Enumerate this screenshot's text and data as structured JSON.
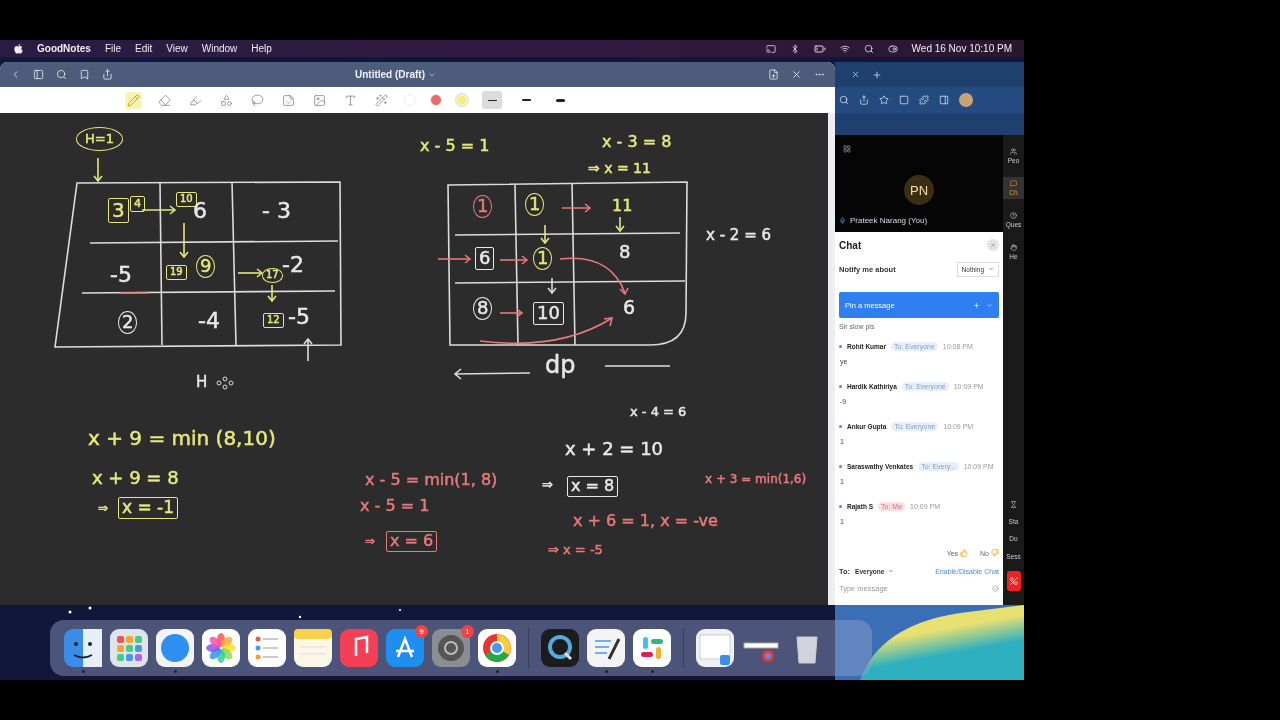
{
  "menu_bar": {
    "app": "GoodNotes",
    "menus": [
      "File",
      "Edit",
      "View",
      "Window",
      "Help"
    ],
    "clock": "Wed 16 Nov  10:10 PM"
  },
  "notes_window": {
    "title": "Untitled (Draft)",
    "tools": [
      {
        "selected": true
      },
      {
        "selected": false
      },
      {
        "selected": false
      },
      {
        "selected": false
      },
      {
        "selected": false
      },
      {
        "selected": false
      },
      {
        "selected": false
      },
      {
        "selected": false
      },
      {
        "selected": false
      }
    ],
    "colors": [
      {
        "color": "#ffffff",
        "selected": false
      },
      {
        "color": "#e86a6a",
        "selected": false
      },
      {
        "color": "#eef07a",
        "selected": true
      }
    ],
    "widths": [
      {
        "selected": true
      },
      {
        "selected": false
      },
      {
        "selected": false
      }
    ],
    "notes": [
      {
        "text": "H=1",
        "color": "#e6e77c",
        "kind": "oval"
      },
      {
        "text": "3",
        "color": "#e6e77c",
        "kind": "boxed"
      },
      {
        "text": "4",
        "color": "#e6e77c",
        "kind": "boxed"
      },
      {
        "text": "10",
        "color": "#e6e77c",
        "kind": "boxed"
      },
      {
        "text": "6",
        "color": "#e8e8e8",
        "kind": "plain"
      },
      {
        "text": "- 3",
        "color": "#e8e8e8",
        "kind": "plain"
      },
      {
        "text": "-5",
        "color": "#e8e8e8",
        "kind": "plain"
      },
      {
        "text": "19",
        "color": "#e6e77c",
        "kind": "boxed"
      },
      {
        "text": "9",
        "color": "#e6e77c",
        "kind": "circled"
      },
      {
        "text": "17",
        "color": "#e6e77c",
        "kind": "circled"
      },
      {
        "text": "-2",
        "color": "#e8e8e8",
        "kind": "plain"
      },
      {
        "text": "2",
        "color": "#e8e8e8",
        "kind": "circled"
      },
      {
        "text": "-4",
        "color": "#e8e8e8",
        "kind": "plain"
      },
      {
        "text": "12",
        "color": "#e6e77c",
        "kind": "boxed"
      },
      {
        "text": "-5",
        "color": "#e8e8e8",
        "kind": "plain"
      },
      {
        "text": "H",
        "color": "#e8e8e8",
        "kind": "plain"
      },
      {
        "text": "x + 9 = min (8,10)",
        "color": "#e6e77c",
        "kind": "plain"
      },
      {
        "text": "x + 9 = 8",
        "color": "#e6e77c",
        "kind": "plain"
      },
      {
        "text": "⇒",
        "color": "#e6e77c",
        "kind": "plain"
      },
      {
        "text": "x = -1",
        "color": "#e6e77c",
        "kind": "boxed"
      },
      {
        "text": "x - 5 = 1",
        "color": "#e6e77c",
        "kind": "plain"
      },
      {
        "text": "x - 3 = 8",
        "color": "#e6e77c",
        "kind": "plain"
      },
      {
        "text": "⇒ x = 11",
        "color": "#e6e77c",
        "kind": "plain"
      },
      {
        "text": "1",
        "color": "#e8787a",
        "kind": "circled"
      },
      {
        "text": "1",
        "color": "#e6e77c",
        "kind": "circled"
      },
      {
        "text": "11",
        "color": "#e6e77c",
        "kind": "plain"
      },
      {
        "text": "6",
        "color": "#e8e8e8",
        "kind": "boxed"
      },
      {
        "text": "1",
        "color": "#e6e77c",
        "kind": "circled"
      },
      {
        "text": "8",
        "color": "#e8e8e8",
        "kind": "plain"
      },
      {
        "text": "8",
        "color": "#e8e8e8",
        "kind": "circled"
      },
      {
        "text": "10",
        "color": "#e8e8e8",
        "kind": "boxed"
      },
      {
        "text": "6",
        "color": "#e8e8e8",
        "kind": "plain"
      },
      {
        "text": "x - 2 = 6",
        "color": "#e8e8e8",
        "kind": "plain"
      },
      {
        "text": "dp",
        "color": "#e8e8e8",
        "kind": "plain"
      },
      {
        "text": "x - 4 = 6",
        "color": "#e8e8e8",
        "kind": "plain"
      },
      {
        "text": "x + 2 = 10",
        "color": "#e8e8e8",
        "kind": "plain"
      },
      {
        "text": "x - 5 = min(1, 8)",
        "color": "#e8787a",
        "kind": "plain"
      },
      {
        "text": "⇒",
        "color": "#e8e8e8",
        "kind": "plain"
      },
      {
        "text": "x = 8",
        "color": "#e8e8e8",
        "kind": "boxed"
      },
      {
        "text": "x + 3 = min(1,6)",
        "color": "#e8787a",
        "kind": "plain"
      },
      {
        "text": "x - 5 = 1",
        "color": "#e8787a",
        "kind": "plain"
      },
      {
        "text": "⇒",
        "color": "#e8787a",
        "kind": "plain"
      },
      {
        "text": "x = 6",
        "color": "#e8787a",
        "kind": "boxed"
      },
      {
        "text": "x + 6 = 1, x = -ve",
        "color": "#e8787a",
        "kind": "plain"
      },
      {
        "text": "⇒ x = -5",
        "color": "#e8787a",
        "kind": "plain"
      }
    ]
  },
  "meeting": {
    "initials": "PN",
    "self_name": "Prateek Narang (You)",
    "side_tabs": [
      {
        "label": "Peo",
        "selected": false
      },
      {
        "label": "Ch",
        "selected": true
      },
      {
        "label": "Ques",
        "selected": false
      },
      {
        "label": "He",
        "selected": false
      }
    ],
    "session_lines": [
      "Sta",
      "Do",
      "Sess"
    ],
    "chat": {
      "title": "Chat",
      "notify_label": "Notify me about",
      "notify_value": "Nothing",
      "pin": "Pin a message",
      "pinned_text": "Sir slow pls",
      "messages": [
        {
          "name": "Rohit Kumar",
          "to": "To: Everyone",
          "kind": "public",
          "time": "10:08 PM",
          "text": "ye"
        },
        {
          "name": "Hardik Kathiriya",
          "to": "To: Everyone",
          "kind": "public",
          "time": "10:09 PM",
          "text": "-9"
        },
        {
          "name": "Ankur Gupta",
          "to": "To: Everyone",
          "kind": "public",
          "time": "10:09 PM",
          "text": "1"
        },
        {
          "name": "Saraswathy Venkates",
          "to": "To: Every...",
          "kind": "public",
          "time": "10:09 PM",
          "text": "1"
        },
        {
          "name": "Rajath S",
          "to": "To: Me",
          "kind": "private",
          "time": "10:09 PM",
          "text": "1"
        }
      ],
      "yes": "Yes",
      "no": "No",
      "to_label": "To:",
      "to_value": "Everyone",
      "toggle_link": "Enable/Disable Chat",
      "placeholder": "Type message"
    }
  },
  "dock": {
    "items": [
      {
        "running": true
      },
      {
        "running": false
      },
      {
        "running": true
      },
      {
        "running": false
      },
      {
        "running": false
      },
      {
        "running": false
      },
      {
        "running": false
      },
      {
        "running": false,
        "badge": "9"
      },
      {
        "running": false,
        "badge": "1"
      },
      {
        "running": true
      },
      {
        "running": false
      },
      {
        "running": true
      },
      {
        "running": true
      },
      {
        "running": false
      },
      {
        "running": false
      },
      {
        "running": false
      }
    ]
  }
}
